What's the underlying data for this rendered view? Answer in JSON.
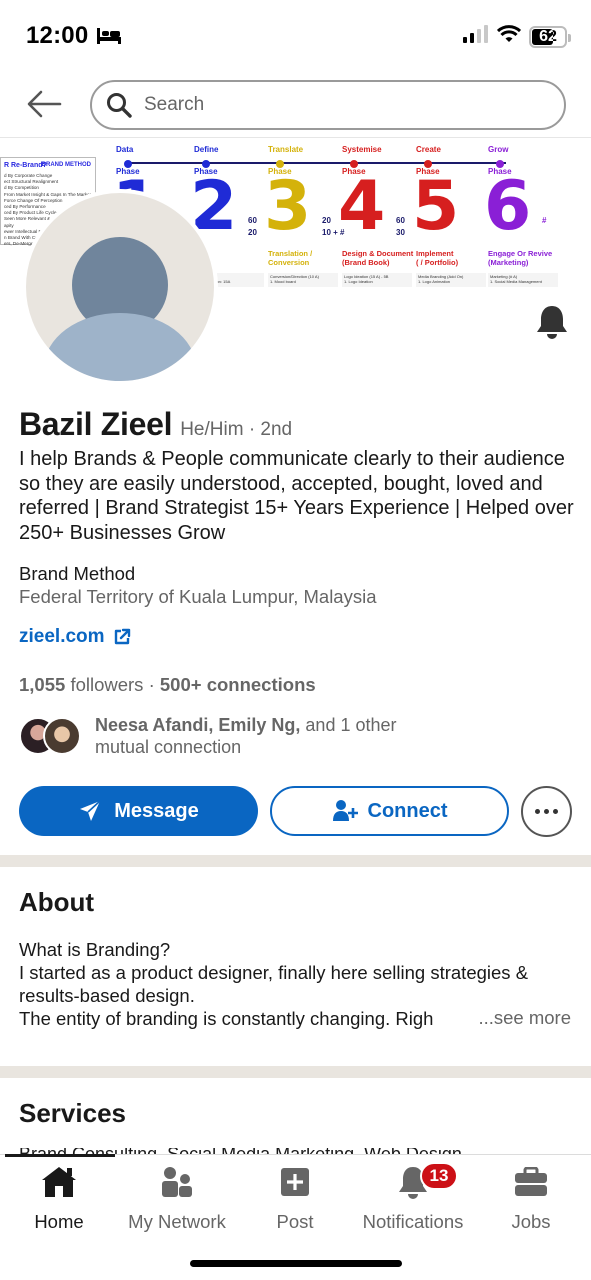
{
  "status_bar": {
    "time": "12:00",
    "battery": "62"
  },
  "search": {
    "placeholder": "Search"
  },
  "banner": {
    "left_card": {
      "title": "R Re-Brand?",
      "brand": "BRAND METHOD",
      "lines": [
        "d By Corporate Change",
        "ect Structural Realignment",
        "d By Competition",
        "From Market Insight & Gaps In The Market",
        "Force Change Of Perception",
        "ced By Performance",
        "ced By Product Life Cycle",
        "Seen More Relevant & Auth",
        "apity",
        "ewer Intellectual Prop",
        "n Brand With Corpo",
        "ers, De-Mergers A"
      ]
    },
    "phases": [
      {
        "stage": "Data",
        "word": "Phase",
        "num": "1",
        "color": "#1f2bd6",
        "title": "",
        "nums": ""
      },
      {
        "stage": "Define",
        "word": "Phase",
        "num": "2",
        "color": "#1f2bd6",
        "title": "y &\ne",
        "nums": "60\n20"
      },
      {
        "stage": "Translate",
        "word": "Phase",
        "num": "3",
        "color": "#d4b20b",
        "title": "Translation /\nConversion",
        "nums": "20\n10 + #"
      },
      {
        "stage": "Systemise",
        "word": "Phase",
        "num": "4",
        "color": "#d61f1f",
        "title": "Design & Document\n(Brand Book)",
        "nums": "60\n30"
      },
      {
        "stage": "Create",
        "word": "Phase",
        "num": "5",
        "color": "#d61f1f",
        "title": "Implement\n( / Portfolio)",
        "nums": ""
      },
      {
        "stage": "Grow",
        "word": "Phase",
        "num": "6",
        "color": "#8a1fd6",
        "title": "Engage Or Revive\n(Marketing)",
        "nums": "#"
      }
    ],
    "details": [
      "354 -14 6\nommunication: 15A",
      "Conversion/Direction (10 A)\n1. Mood board",
      "Logo Ideation (15 A) - 5B\n1. Logo Ideation",
      "Media Branding (Add On)\n1. Logo Animation",
      "Marketing (# A)\n1. Social Media Management"
    ]
  },
  "profile": {
    "name": "Bazil Zieel",
    "pronoun_degree": "He/Him · 2nd",
    "headline": "I help Brands & People communicate clearly to their audience so they are easily understood, accepted, bought, loved and referred | Brand Strategist 15+ Years Experience | Helped over 250+ Businesses Grow",
    "company": "Brand Method",
    "location": "Federal Territory of Kuala Lumpur, Malaysia",
    "website": "zieel.com",
    "followers": "1,055",
    "followers_label": "followers",
    "separator": "·",
    "connections": "500+ connections",
    "mutual_names": "Neesa Afandi, Emily Ng,",
    "mutual_rest": "and 1 other mutual connection"
  },
  "actions": {
    "message": "Message",
    "connect": "Connect"
  },
  "about": {
    "title": "About",
    "line1": "What is Branding?",
    "line2": "I started as a product designer, finally here selling strategies & results-based design.",
    "line3": "The entity of branding is constantly changing. Righ",
    "see_more": "...see more"
  },
  "services": {
    "title": "Services",
    "peek": "Brand Consulting, Social Media Marketing, Web Design"
  },
  "tabbar": {
    "tabs": [
      {
        "label": "Home"
      },
      {
        "label": "My Network"
      },
      {
        "label": "Post"
      },
      {
        "label": "Notifications",
        "badge": "13"
      },
      {
        "label": "Jobs"
      }
    ]
  },
  "colors": {
    "primary": "#0a66c2",
    "badge": "#cc1016",
    "divider": "#e9e5df",
    "muted_text": "#666666"
  },
  "icons": [
    "bed-icon",
    "signal-icon",
    "wifi-icon",
    "battery-icon",
    "back-arrow-icon",
    "search-icon",
    "bell-icon",
    "external-link-icon",
    "send-icon",
    "add-person-icon",
    "more-icon",
    "home-icon",
    "network-icon",
    "post-icon",
    "notifications-icon",
    "jobs-icon"
  ]
}
